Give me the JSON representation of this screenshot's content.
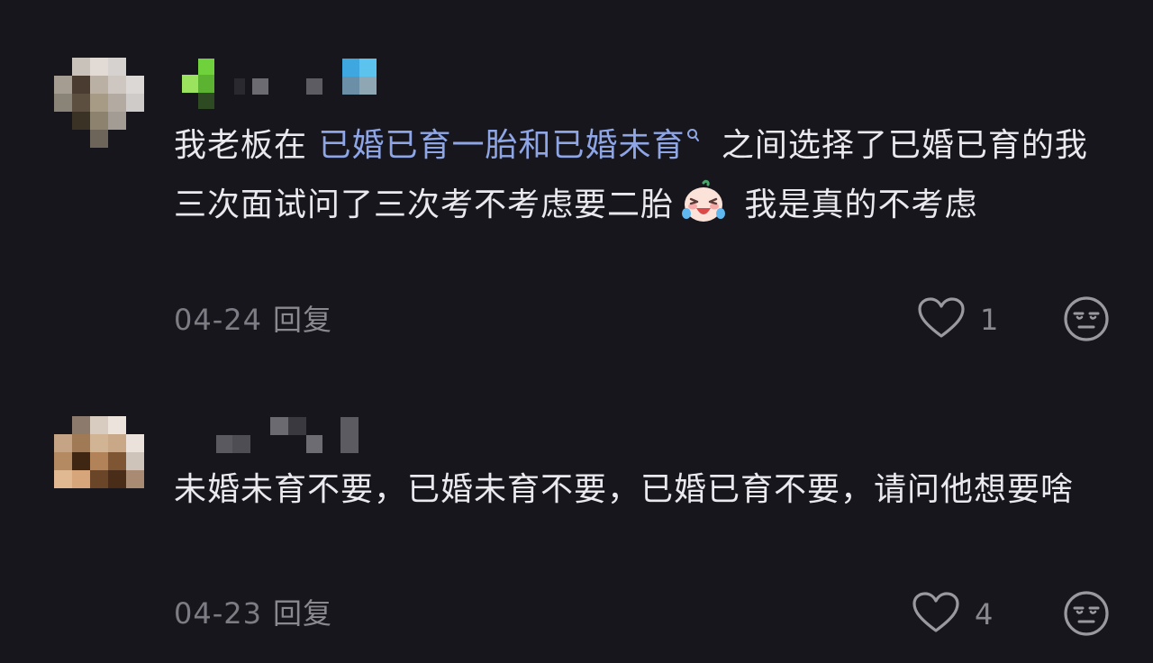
{
  "comments": [
    {
      "text_before": "我老板在 ",
      "keyword": "已婚已育一胎和已婚未育",
      "text_after_1": " 之间选择了已婚已育的我 三次面试问了三次考不考虑要二胎",
      "emoji_name": "crying-laughing-emoji",
      "text_after_2": " 我是真的不考虑",
      "date": "04-24",
      "reply_label": "回复",
      "likes": "1"
    },
    {
      "text": "未婚未育不要，已婚未育不要，已婚已育不要，请问他想要啥",
      "date": "04-23",
      "reply_label": "回复",
      "likes": "4"
    }
  ],
  "icons": {
    "like": "heart-outline-icon",
    "dislike": "unamused-face-icon",
    "search": "search-icon"
  },
  "colors": {
    "background": "#17161c",
    "text": "#e9e9ee",
    "keyword": "#8fa6e6",
    "meta": "#7d7c84"
  }
}
